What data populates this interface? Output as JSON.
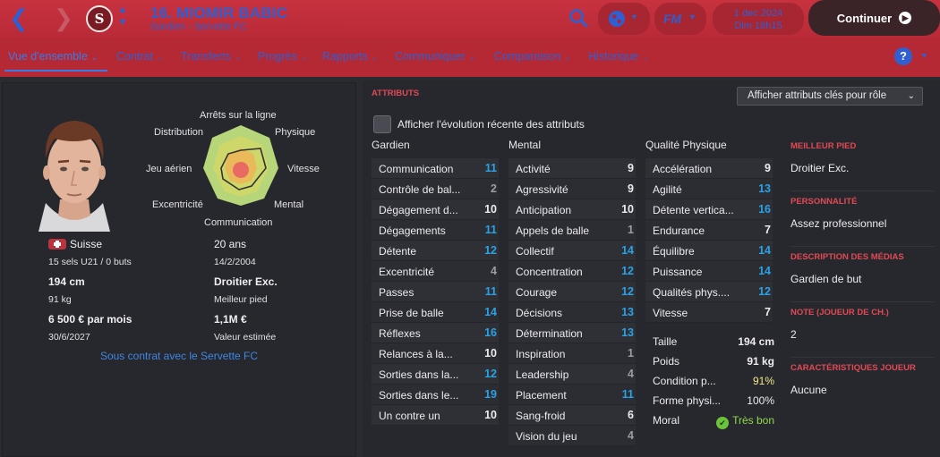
{
  "header": {
    "player_name": "16. MIOMIR BABIC",
    "player_subtitle": "Gardien - Servette FC",
    "club_badge_letter": "S",
    "date": "1 dec 2024",
    "time": "Dim 18h15",
    "fm_label": "FM",
    "continue_label": "Continuer"
  },
  "tabs": [
    {
      "label": "Vue d'ensemble"
    },
    {
      "label": "Contrat"
    },
    {
      "label": "Transferts"
    },
    {
      "label": "Progrès"
    },
    {
      "label": "Rapports"
    },
    {
      "label": "Communiquer"
    },
    {
      "label": "Comparaison"
    },
    {
      "label": "Historique"
    }
  ],
  "help_label": "?",
  "profile": {
    "radar_labels": {
      "top": "Arrêts sur la ligne",
      "top_left": "Distribution",
      "top_right": "Physique",
      "left": "Jeu aérien",
      "right": "Vitesse",
      "bottom_left": "Excentricité",
      "bottom_right": "Mental",
      "bottom": "Communication"
    },
    "nationality": "Suisse",
    "caps": "15 sels U21 / 0 buts",
    "age": "20 ans",
    "birthdate": "14/2/2004",
    "height": "194 cm",
    "weight": "91 kg",
    "foot": "Droitier Exc.",
    "foot_label": "Meilleur pied",
    "wage": "6 500 € par mois",
    "contract_end": "30/6/2027",
    "value": "1,1M €",
    "value_label": "Valeur estimée",
    "contract_text": "Sous contrat avec le Servette FC"
  },
  "attributes": {
    "title": "ATTRIBUTS",
    "role_select": "Afficher attributs clés pour rôle",
    "evolution_label": "Afficher l'évolution récente des attributs",
    "gardien_header": "Gardien",
    "mental_header": "Mental",
    "physique_header": "Qualité Physique",
    "gardien": [
      {
        "name": "Communication",
        "value": "11",
        "color": "blue"
      },
      {
        "name": "Contrôle de bal...",
        "value": "2",
        "color": "grey"
      },
      {
        "name": "Dégagement d...",
        "value": "10",
        "color": "white"
      },
      {
        "name": "Dégagements",
        "value": "11",
        "color": "blue"
      },
      {
        "name": "Détente",
        "value": "12",
        "color": "blue"
      },
      {
        "name": "Excentricité",
        "value": "4",
        "color": "grey"
      },
      {
        "name": "Passes",
        "value": "11",
        "color": "blue"
      },
      {
        "name": "Prise de balle",
        "value": "14",
        "color": "blue"
      },
      {
        "name": "Réflexes",
        "value": "16",
        "color": "blue"
      },
      {
        "name": "Relances à la...",
        "value": "10",
        "color": "white"
      },
      {
        "name": "Sorties dans la...",
        "value": "12",
        "color": "blue"
      },
      {
        "name": "Sorties dans le...",
        "value": "19",
        "color": "blue"
      },
      {
        "name": "Un contre un",
        "value": "10",
        "color": "white"
      }
    ],
    "mental": [
      {
        "name": "Activité",
        "value": "9",
        "color": "white"
      },
      {
        "name": "Agressivité",
        "value": "9",
        "color": "white"
      },
      {
        "name": "Anticipation",
        "value": "10",
        "color": "white"
      },
      {
        "name": "Appels de balle",
        "value": "1",
        "color": "grey"
      },
      {
        "name": "Collectif",
        "value": "14",
        "color": "blue"
      },
      {
        "name": "Concentration",
        "value": "12",
        "color": "blue"
      },
      {
        "name": "Courage",
        "value": "12",
        "color": "blue"
      },
      {
        "name": "Décisions",
        "value": "13",
        "color": "blue"
      },
      {
        "name": "Détermination",
        "value": "13",
        "color": "blue"
      },
      {
        "name": "Inspiration",
        "value": "1",
        "color": "grey"
      },
      {
        "name": "Leadership",
        "value": "4",
        "color": "grey"
      },
      {
        "name": "Placement",
        "value": "11",
        "color": "blue"
      },
      {
        "name": "Sang-froid",
        "value": "6",
        "color": "white"
      },
      {
        "name": "Vision du jeu",
        "value": "4",
        "color": "grey"
      }
    ],
    "physique": [
      {
        "name": "Accélération",
        "value": "9",
        "color": "white"
      },
      {
        "name": "Agilité",
        "value": "13",
        "color": "blue"
      },
      {
        "name": "Détente vertica...",
        "value": "16",
        "color": "blue"
      },
      {
        "name": "Endurance",
        "value": "7",
        "color": "white"
      },
      {
        "name": "Équilibre",
        "value": "14",
        "color": "blue"
      },
      {
        "name": "Puissance",
        "value": "14",
        "color": "blue"
      },
      {
        "name": "Qualités phys....",
        "value": "12",
        "color": "blue"
      },
      {
        "name": "Vitesse",
        "value": "7",
        "color": "white"
      }
    ],
    "physical_extra": [
      {
        "name": "Taille",
        "value": "194 cm",
        "style": "b"
      },
      {
        "name": "Poids",
        "value": "91 kg",
        "style": "b"
      },
      {
        "name": "Condition p...",
        "value": "91%",
        "style": "y"
      },
      {
        "name": "Forme physi...",
        "value": "100%",
        "style": ""
      },
      {
        "name": "Moral",
        "value": "Très bon",
        "style": "g"
      }
    ]
  },
  "side_info": {
    "foot_title": "MEILLEUR PIED",
    "foot_value": "Droitier Exc.",
    "personality_title": "PERSONNALITÉ",
    "personality_value": "Assez professionnel",
    "media_title": "DESCRIPTION DES MÉDIAS",
    "media_value": "Gardien de but",
    "rating_title": "NOTE (JOUEUR DE CH.)",
    "rating_value": "2",
    "traits_title": "CARACTÉRISTIQUES JOUEUR",
    "traits_value": "Aucune"
  },
  "colors": {
    "header_red": "#b92a37",
    "accent_blue": "#2f5fd0",
    "attr_blue": "#29a2e6",
    "panel_bg": "#27282d"
  }
}
